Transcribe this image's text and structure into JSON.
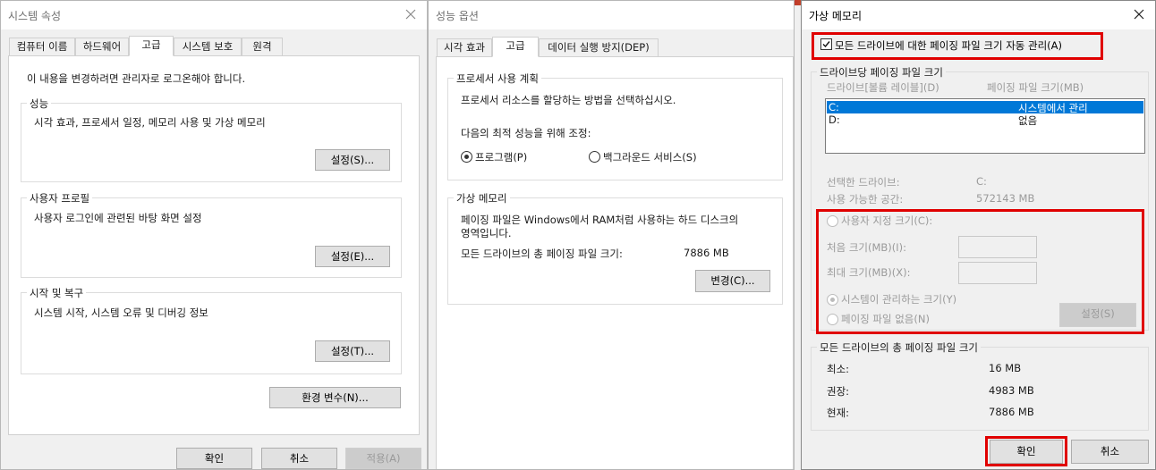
{
  "system_properties": {
    "title": "시스템 속성",
    "tabs": [
      "컴퓨터 이름",
      "하드웨어",
      "고급",
      "시스템 보호",
      "원격"
    ],
    "admin_note": "이 내용을 변경하려면 관리자로 로그온해야 합니다.",
    "performance": {
      "label": "성능",
      "desc": "시각 효과, 프로세서 일정, 메모리 사용 및 가상 메모리",
      "button": "설정(S)..."
    },
    "user_profiles": {
      "label": "사용자 프로필",
      "desc": "사용자 로그인에 관련된 바탕 화면 설정",
      "button": "설정(E)..."
    },
    "startup_recovery": {
      "label": "시작 및 복구",
      "desc": "시스템 시작, 시스템 오류 및 디버깅 정보",
      "button": "설정(T)..."
    },
    "env_button": "환경 변수(N)...",
    "ok": "확인",
    "cancel": "취소",
    "apply": "적용(A)"
  },
  "performance_options": {
    "title": "성능 옵션",
    "tabs": [
      "시각 효과",
      "고급",
      "데이터 실행 방지(DEP)"
    ],
    "processor": {
      "label": "프로세서 사용 계획",
      "desc": "프로세서 리소스를 할당하는 방법을 선택하십시오.",
      "adjust": "다음의 최적 성능을 위해 조정:",
      "opt_programs": "프로그램(P)",
      "opt_services": "백그라운드 서비스(S)"
    },
    "virtual_memory": {
      "label": "가상 메모리",
      "desc_line1": "페이징 파일은 Windows에서 RAM처럼 사용하는 하드 디스크의",
      "desc_line2": "영역입니다.",
      "total_label": "모든 드라이브의 총 페이징 파일 크기:",
      "total_value": "7886 MB",
      "change_button": "변경(C)..."
    }
  },
  "virtual_memory_dialog": {
    "title": "가상 메모리",
    "auto_manage": "모든 드라이브에 대한 페이징 파일 크기 자동 관리(A)",
    "auto_manage_checked": true,
    "per_drive": {
      "label": "드라이브당 페이징 파일 크기",
      "col_drive": "드라이브[볼륨 레이블](D)",
      "col_size": "페이징 파일 크기(MB)",
      "rows": [
        {
          "drive": "C:",
          "size": "시스템에서 관리",
          "selected": true
        },
        {
          "drive": "D:",
          "size": "없음",
          "selected": false
        }
      ]
    },
    "selected_drive_label": "선택한 드라이브:",
    "selected_drive_value": "C:",
    "free_space_label": "사용 가능한 공간:",
    "free_space_value": "572143 MB",
    "custom_size": "사용자 지정 크기(C):",
    "initial_size": "처음 크기(MB)(I):",
    "max_size": "최대 크기(MB)(X):",
    "system_managed": "시스템이 관리하는 크기(Y)",
    "no_paging": "페이징 파일 없음(N)",
    "set_button": "설정(S)",
    "totals": {
      "label": "모든 드라이브의 총 페이징 파일 크기",
      "min_label": "최소:",
      "min_value": "16 MB",
      "rec_label": "권장:",
      "rec_value": "4983 MB",
      "cur_label": "현재:",
      "cur_value": "7886 MB"
    },
    "ok": "확인",
    "cancel": "취소"
  },
  "highlight_color": "#e00000",
  "selection_color": "#0078d7"
}
